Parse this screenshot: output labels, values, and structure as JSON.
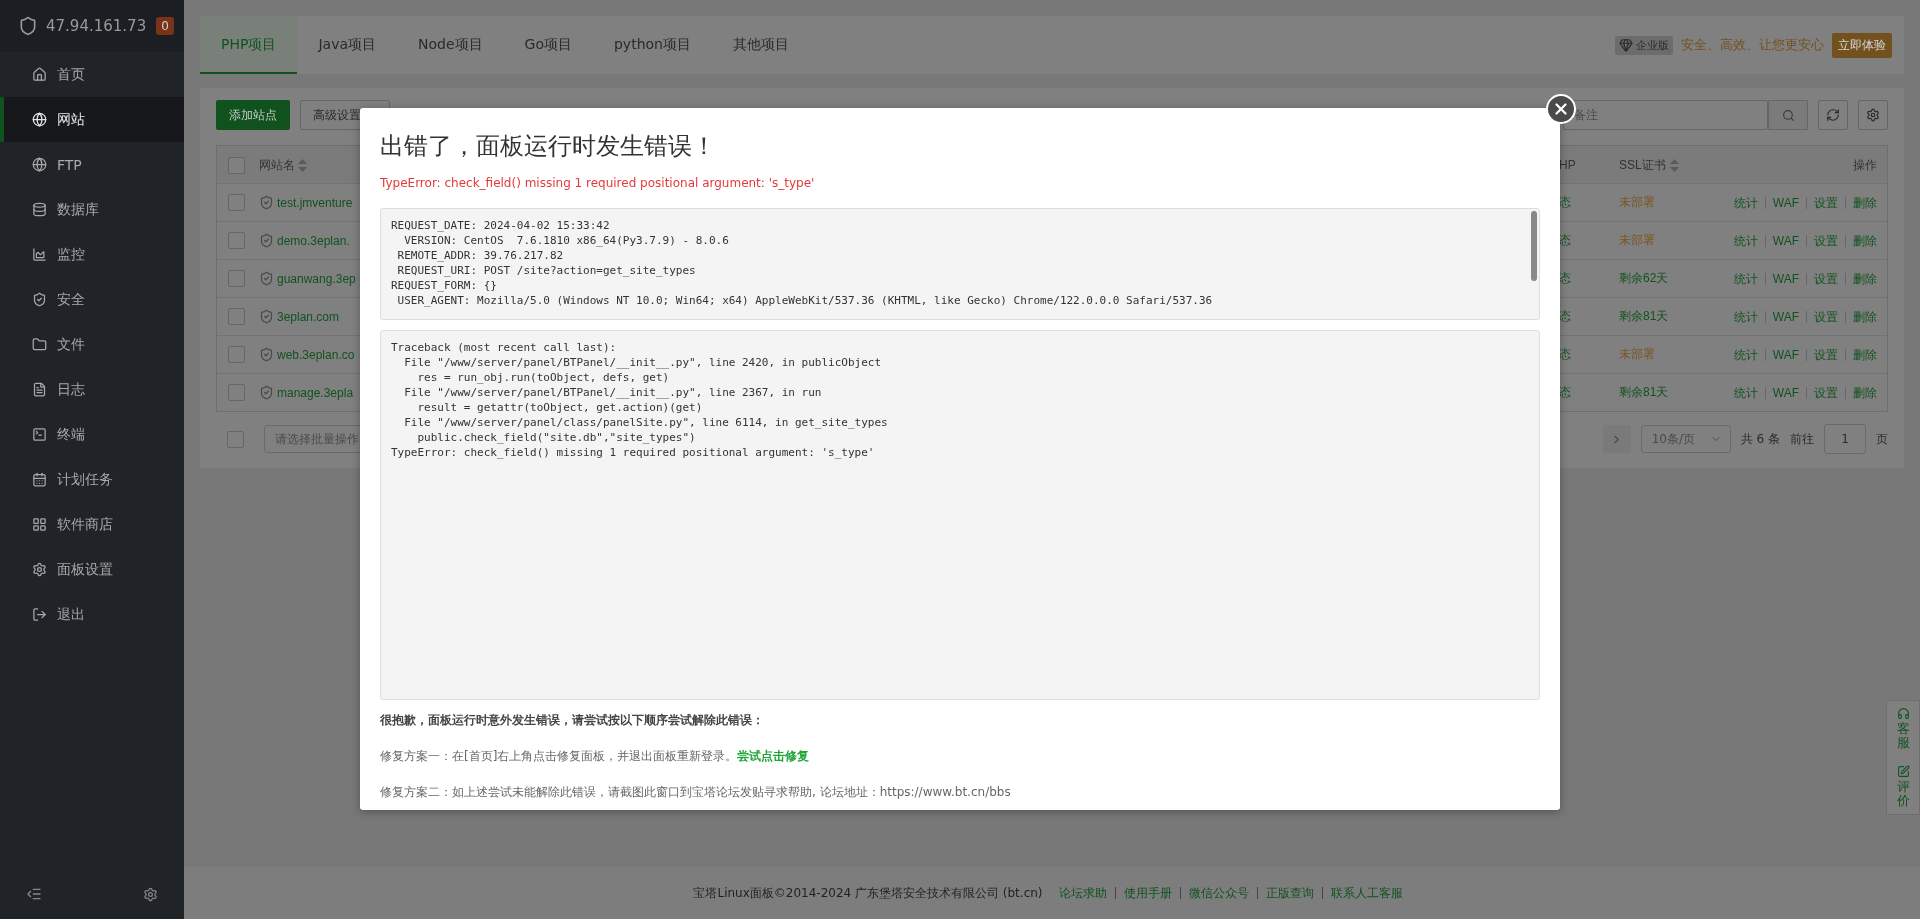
{
  "server": {
    "ip": "47.94.161.73",
    "badge": "0"
  },
  "nav": [
    {
      "label": "首页",
      "selected": false
    },
    {
      "label": "网站",
      "selected": true
    },
    {
      "label": "FTP",
      "selected": false
    },
    {
      "label": "数据库",
      "selected": false
    },
    {
      "label": "监控",
      "selected": false
    },
    {
      "label": "安全",
      "selected": false
    },
    {
      "label": "文件",
      "selected": false
    },
    {
      "label": "日志",
      "selected": false
    },
    {
      "label": "终端",
      "selected": false
    },
    {
      "label": "计划任务",
      "selected": false
    },
    {
      "label": "软件商店",
      "selected": false
    },
    {
      "label": "面板设置",
      "selected": false
    },
    {
      "label": "退出",
      "selected": false
    }
  ],
  "tabs": [
    {
      "label": "PHP项目",
      "selected": true
    },
    {
      "label": "Java项目",
      "selected": false
    },
    {
      "label": "Node项目",
      "selected": false
    },
    {
      "label": "Go项目",
      "selected": false
    },
    {
      "label": "python项目",
      "selected": false
    },
    {
      "label": "其他项目",
      "selected": false
    }
  ],
  "promo": {
    "badge": "企业版",
    "text": "安全、高效、让您更安心",
    "button": "立即体验"
  },
  "toolbar": {
    "add_button": "添加站点",
    "advanced_button": "高级设置",
    "search_placeholder": "备注"
  },
  "table": {
    "columns": [
      "网站名",
      "HP",
      "SSL证书",
      "操作"
    ],
    "select_all_checked": false,
    "rows": [
      {
        "checked": false,
        "name": "test.jmventure",
        "php": "态",
        "ssl": {
          "text": "未部署",
          "color": "#7a5520"
        },
        "actions": [
          "统计",
          "WAF",
          "设置",
          "删除"
        ]
      },
      {
        "checked": false,
        "name": "demo.3eplan.",
        "php": "态",
        "ssl": {
          "text": "未部署",
          "color": "#7a5520"
        },
        "actions": [
          "统计",
          "WAF",
          "设置",
          "删除"
        ]
      },
      {
        "checked": false,
        "name": "guanwang.3ep",
        "php": "态",
        "ssl": {
          "text": "剩余62天",
          "color": "#10521d"
        },
        "actions": [
          "统计",
          "WAF",
          "设置",
          "删除"
        ]
      },
      {
        "checked": false,
        "name": "3eplan.com",
        "php": "态",
        "ssl": {
          "text": "剩余81天",
          "color": "#10521d"
        },
        "actions": [
          "统计",
          "WAF",
          "设置",
          "删除"
        ]
      },
      {
        "checked": false,
        "name": "web.3eplan.co",
        "php": "态",
        "ssl": {
          "text": "未部署",
          "color": "#7a5520"
        },
        "actions": [
          "统计",
          "WAF",
          "设置",
          "删除"
        ]
      },
      {
        "checked": false,
        "name": "manage.3epla",
        "php": "态",
        "ssl": {
          "text": "剩余81天",
          "color": "#10521d"
        },
        "actions": [
          "统计",
          "WAF",
          "设置",
          "删除"
        ]
      }
    ]
  },
  "pagination": {
    "batch_checked": false,
    "batch_placeholder": "请选择批量操作",
    "page_size": "10条/页",
    "total": "共 6 条",
    "goto": "前往",
    "page": "1",
    "page_suffix": "页"
  },
  "modal": {
    "title": "出错了，面板运行时发生错误！",
    "error": "TypeError: check_field() missing 1 required positional argument: 's_type'",
    "request_lines": [
      "REQUEST_DATE: 2024-04-02 15:33:42",
      "  VERSION: CentOS  7.6.1810 x86_64(Py3.7.9) - 8.0.6",
      " REMOTE_ADDR: 39.76.217.82",
      " REQUEST_URI: POST /site?action=get_site_types",
      "REQUEST_FORM: {}",
      " USER_AGENT: Mozilla/5.0 (Windows NT 10.0; Win64; x64) AppleWebKit/537.36 (KHTML, like Gecko) Chrome/122.0.0.0 Safari/537.36"
    ],
    "traceback_lines": [
      "Traceback (most recent call last):",
      "  File \"/www/server/panel/BTPanel/__init__.py\", line 2420, in publicObject",
      "    res = run_obj.run(toObject, defs, get)",
      "  File \"/www/server/panel/BTPanel/__init__.py\", line 2367, in run",
      "    result = getattr(toObject, get.action)(get)",
      "  File \"/www/server/panel/class/panelSite.py\", line 6114, in get_site_types",
      "    public.check_field(\"site.db\",\"site_types\")",
      "TypeError: check_field() missing 1 required positional argument: 's_type'"
    ],
    "apology": "很抱歉，面板运行时意外发生错误，请尝试按以下顺序尝试解除此错误：",
    "fix1": {
      "text": "修复方案一：在[首页]右上角点击修复面板，并退出面板重新登录。",
      "link": "尝试点击修复"
    },
    "fix2": "修复方案二：如上述尝试未能解除此错误，请截图此窗口到宝塔论坛发贴寻求帮助, 论坛地址：https://www.bt.cn/bbs"
  },
  "footer": {
    "copyright": "宝塔Linux面板©2014-2024 广东堡塔安全技术有限公司 (bt.cn)",
    "links": [
      "论坛求助",
      "使用手册",
      "微信公众号",
      "正版查询",
      "联系人工客服"
    ]
  },
  "side_widget": [
    {
      "label": "客服"
    },
    {
      "label": "评价"
    }
  ]
}
